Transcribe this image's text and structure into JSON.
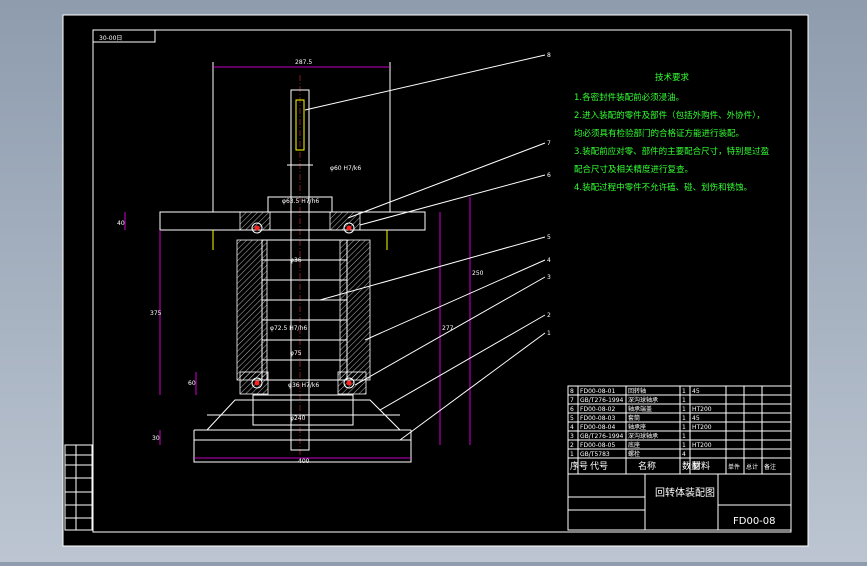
{
  "drawing": {
    "code_box": "30-00日",
    "title": "回转体装配图",
    "drawing_number": "FD00-08"
  },
  "tech_requirements": {
    "heading": "技术要求",
    "lines": [
      "1.各密封件装配前必须浸油。",
      "2.进入装配的零件及部件（包括外购件、外协件），",
      "均必须具有检验部门的合格证方能进行装配。",
      "3.装配前应对零、部件的主要配合尺寸，特别是过盈",
      "配合尺寸及相关精度进行复查。",
      "4.装配过程中零件不允许磕、碰、划伤和锈蚀。"
    ]
  },
  "balloons": [
    "8",
    "7",
    "6",
    "5",
    "4",
    "3",
    "2",
    "1"
  ],
  "dimensions": {
    "top_width": "287.5",
    "h1": "40",
    "h2": "60",
    "total_h": "375",
    "h_right1": "250",
    "h_right2": "277",
    "bottom_w": "400",
    "bottom_h": "30",
    "fit1": "φ60 H7/k6",
    "fit2": "φ63.5 H7/h6",
    "fit3": "φ36",
    "fit4": "φ72.5 H7/h6",
    "fit5": "φ75",
    "fit6": "φ36 H7/k6",
    "fit7": "φ240"
  },
  "bom": {
    "headers": [
      "序号",
      "代号",
      "名称",
      "数量",
      "材料",
      "单件",
      "总计",
      "备注"
    ],
    "rows": [
      [
        "8",
        "FD00-08-01",
        "回转轴",
        "1",
        "45",
        "",
        "",
        ""
      ],
      [
        "7",
        "GB/T276-1994",
        "深沟球轴承",
        "1",
        "",
        "",
        "",
        ""
      ],
      [
        "6",
        "FD00-08-02",
        "轴承端盖",
        "1",
        "HT200",
        "",
        "",
        ""
      ],
      [
        "5",
        "FD00-08-03",
        "套筒",
        "1",
        "45",
        "",
        "",
        ""
      ],
      [
        "4",
        "FD00-08-04",
        "轴承座",
        "1",
        "HT200",
        "",
        "",
        ""
      ],
      [
        "3",
        "GB/T276-1994",
        "深沟球轴承",
        "1",
        "",
        "",
        "",
        ""
      ],
      [
        "2",
        "FD00-08-05",
        "底座",
        "1",
        "HT200",
        "",
        "",
        ""
      ],
      [
        "1",
        "GB/T5783",
        "螺栓",
        "4",
        "",
        "",
        "",
        ""
      ]
    ]
  },
  "colors": {
    "frame": "#ffffff",
    "outline": "#ffffff",
    "hidden": "#ffff00",
    "centerline": "#ff2020",
    "dimension": "#ff00ff",
    "notes": "#33ff33",
    "background": "#000000"
  }
}
